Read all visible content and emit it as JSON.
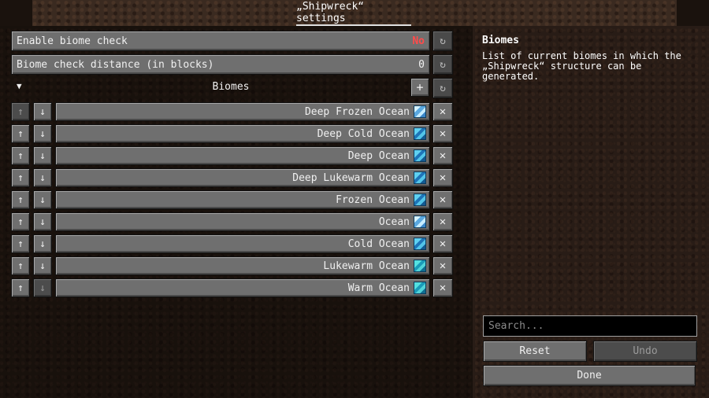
{
  "header": {
    "title": "„Shipwreck“ settings"
  },
  "settings": [
    {
      "label": "Enable biome check",
      "value": "No",
      "reset_icon": "reset-icon"
    },
    {
      "label": "Biome check distance (in blocks)",
      "value": "0",
      "reset_icon": "reset-icon"
    }
  ],
  "biome_list": {
    "header_label": "Biomes",
    "collapse_glyph": "▼",
    "add_glyph": "+",
    "reset_glyph": "↻",
    "up_glyph": "↑",
    "down_glyph": "↓",
    "remove_glyph": "✕",
    "items": [
      {
        "label": "Deep Frozen Ocean",
        "icon": "frozen-ocean-icon"
      },
      {
        "label": "Deep Cold Ocean",
        "icon": "ocean-icon"
      },
      {
        "label": "Deep Ocean",
        "icon": "ocean-icon"
      },
      {
        "label": "Deep Lukewarm Ocean",
        "icon": "ocean-icon"
      },
      {
        "label": "Frozen Ocean",
        "icon": "ocean-icon"
      },
      {
        "label": "Ocean",
        "icon": "frozen-ocean-icon"
      },
      {
        "label": "Cold Ocean",
        "icon": "ocean-icon"
      },
      {
        "label": "Lukewarm Ocean",
        "icon": "warm-ocean-icon"
      },
      {
        "label": "Warm Ocean",
        "icon": "warm-ocean-icon"
      }
    ]
  },
  "info": {
    "title": "Biomes",
    "description": "List of current biomes in which the „Shipwreck“ structure can be generated."
  },
  "search": {
    "placeholder": "Search..."
  },
  "buttons": {
    "reset": "Reset",
    "undo": "Undo",
    "done": "Done"
  },
  "colors": {
    "false_value": "#ff4b4b",
    "button": "#6f6f6f",
    "panel": "#2b1f18"
  }
}
